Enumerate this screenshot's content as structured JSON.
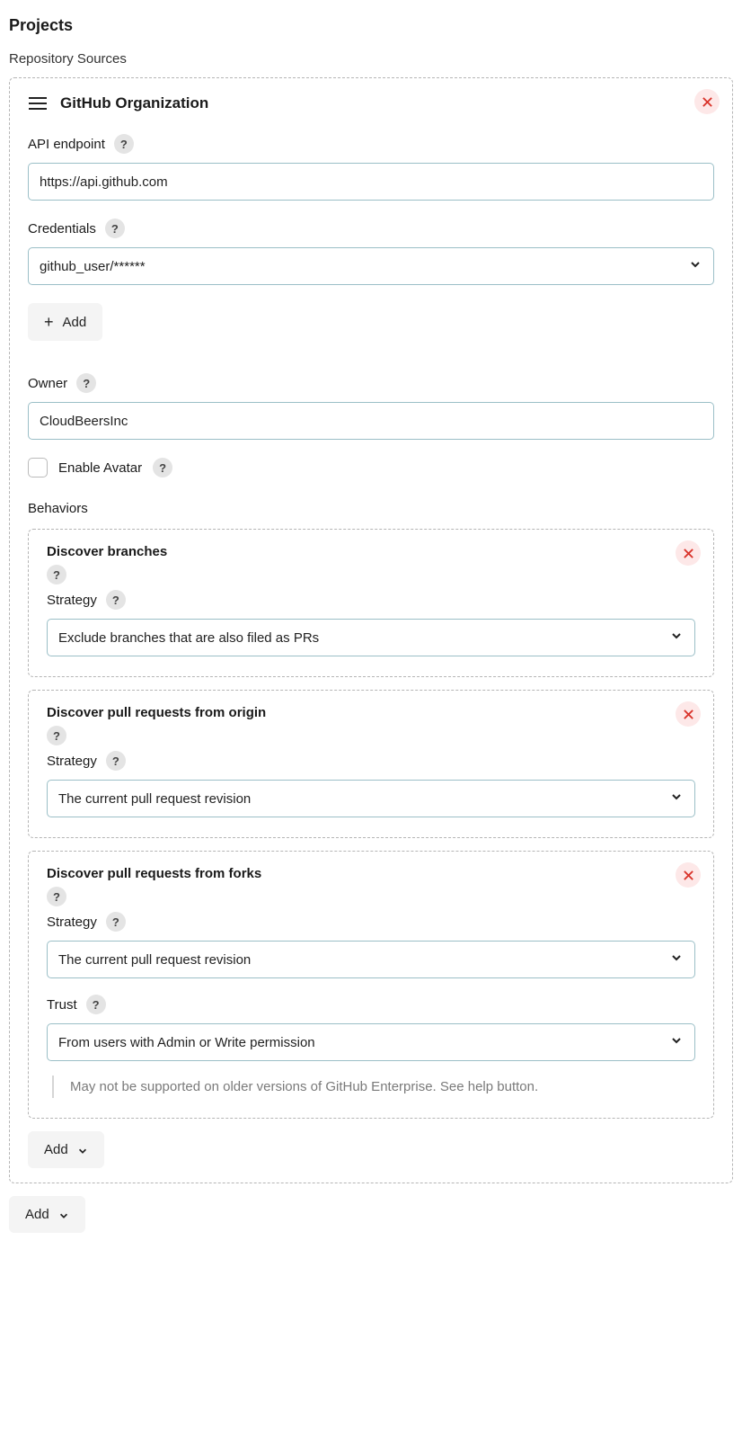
{
  "page_title": "Projects",
  "section_label": "Repository Sources",
  "source": {
    "title": "GitHub Organization",
    "api_endpoint": {
      "label": "API endpoint",
      "value": "https://api.github.com"
    },
    "credentials": {
      "label": "Credentials",
      "value": "github_user/******",
      "add_button": "Add"
    },
    "owner": {
      "label": "Owner",
      "value": "CloudBeersInc"
    },
    "enable_avatar": {
      "label": "Enable Avatar"
    },
    "behaviors_label": "Behaviors",
    "behaviors": [
      {
        "title": "Discover branches",
        "strategy_label": "Strategy",
        "strategy_value": "Exclude branches that are also filed as PRs"
      },
      {
        "title": "Discover pull requests from origin",
        "strategy_label": "Strategy",
        "strategy_value": "The current pull request revision"
      },
      {
        "title": "Discover pull requests from forks",
        "strategy_label": "Strategy",
        "strategy_value": "The current pull request revision",
        "trust_label": "Trust",
        "trust_value": "From users with Admin or Write permission",
        "note": "May not be supported on older versions of GitHub Enterprise. See help button."
      }
    ],
    "add_behavior": "Add"
  },
  "add_source": "Add"
}
